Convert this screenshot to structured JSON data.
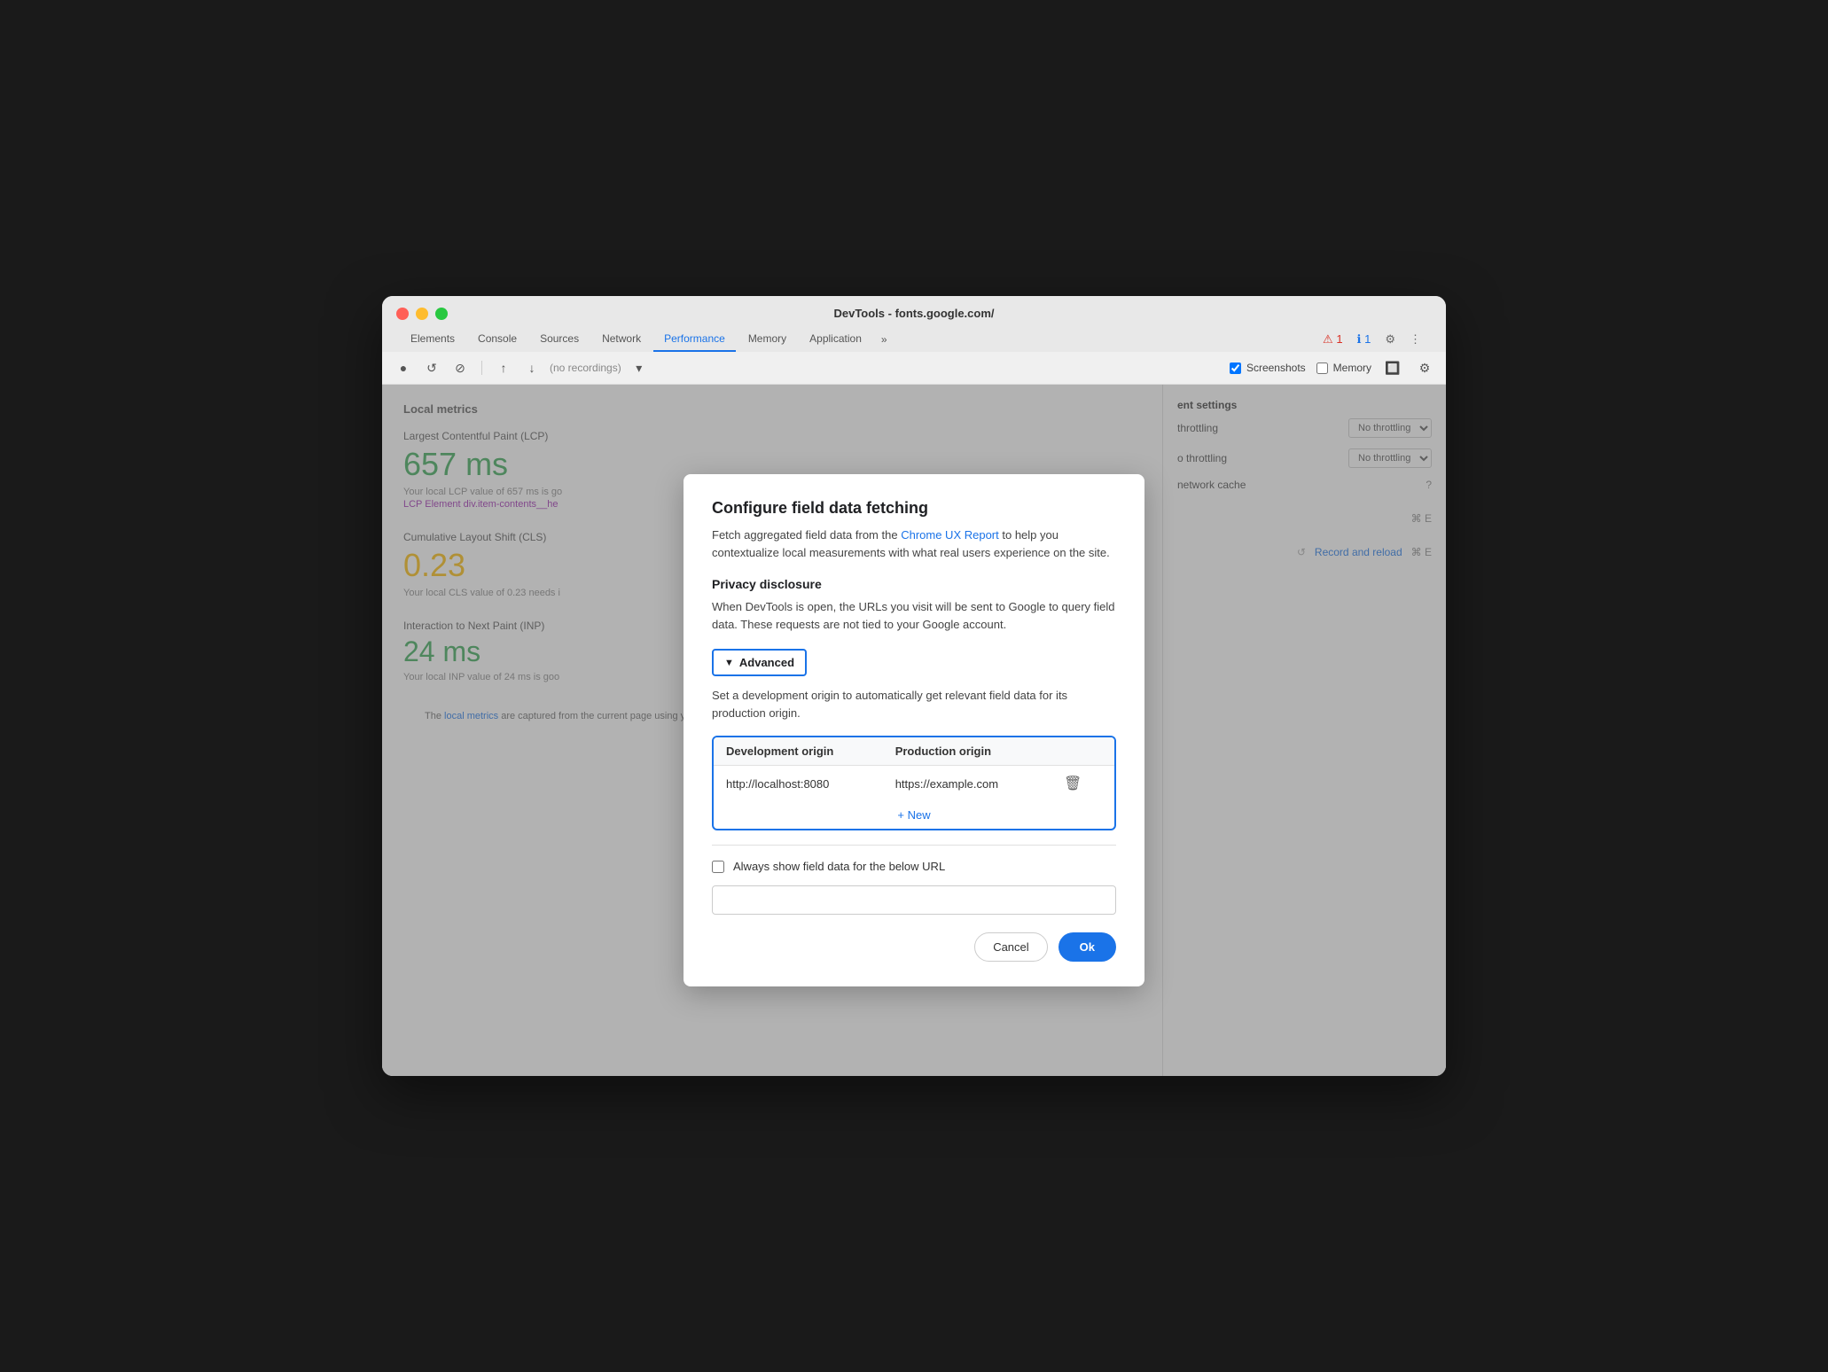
{
  "window": {
    "title": "DevTools - fonts.google.com/"
  },
  "tabs": {
    "items": [
      {
        "label": "Elements",
        "active": false
      },
      {
        "label": "Console",
        "active": false
      },
      {
        "label": "Sources",
        "active": false
      },
      {
        "label": "Network",
        "active": false
      },
      {
        "label": "Performance",
        "active": true
      },
      {
        "label": "Memory",
        "active": false
      },
      {
        "label": "Application",
        "active": false
      }
    ],
    "more": "»",
    "warning_count": "1",
    "info_count": "1"
  },
  "toolbar": {
    "recordings_placeholder": "(no recordings)",
    "screenshots_label": "Screenshots",
    "memory_label": "Memory"
  },
  "left_panel": {
    "title": "Local metrics",
    "metrics": [
      {
        "label": "Largest Contentful Paint (LCP)",
        "value": "657 ms",
        "color": "green",
        "desc": "Your local LCP value of 657 ms is go",
        "element_prefix": "LCP Element",
        "element_value": "div.item-contents__he"
      },
      {
        "label": "Cumulative Layout Shift (CLS)",
        "value": "0.23",
        "color": "orange",
        "desc": "Your local CLS value of 0.23 needs i"
      },
      {
        "label": "Interaction to Next Paint (INP)",
        "value": "24 ms",
        "color": "green",
        "desc": "Your local INP value of 24 ms is goo"
      }
    ],
    "footer": {
      "prefix": "The",
      "link_text": "local metrics",
      "suffix": "are captured from the current page using your network connection and device."
    }
  },
  "right_panel": {
    "section_title": "ent settings",
    "throttling_label": "throttling",
    "throttling_value": "No throttling",
    "network_throttle_label": "o throttling",
    "network_cache_label": "network cache",
    "record_btn": "Record and reload",
    "shortcut": "⌘ E",
    "chrome_ux_link": "Chrome UX Report"
  },
  "modal": {
    "title": "Configure field data fetching",
    "desc_prefix": "Fetch aggregated field data from the",
    "desc_link": "Chrome UX Report",
    "desc_suffix": "to help you contextualize local measurements with what real users experience on the site.",
    "privacy_title": "Privacy disclosure",
    "privacy_text": "When DevTools is open, the URLs you visit will be sent to Google to query field data. These requests are not tied to your Google account.",
    "advanced_label": "Advanced",
    "advanced_desc": "Set a development origin to automatically get relevant field data for its production origin.",
    "table": {
      "col1": "Development origin",
      "col2": "Production origin",
      "rows": [
        {
          "dev": "http://localhost:8080",
          "prod": "https://example.com"
        }
      ]
    },
    "add_new_label": "+ New",
    "always_show_label": "Always show field data for the below URL",
    "url_placeholder": "",
    "cancel_label": "Cancel",
    "ok_label": "Ok"
  }
}
